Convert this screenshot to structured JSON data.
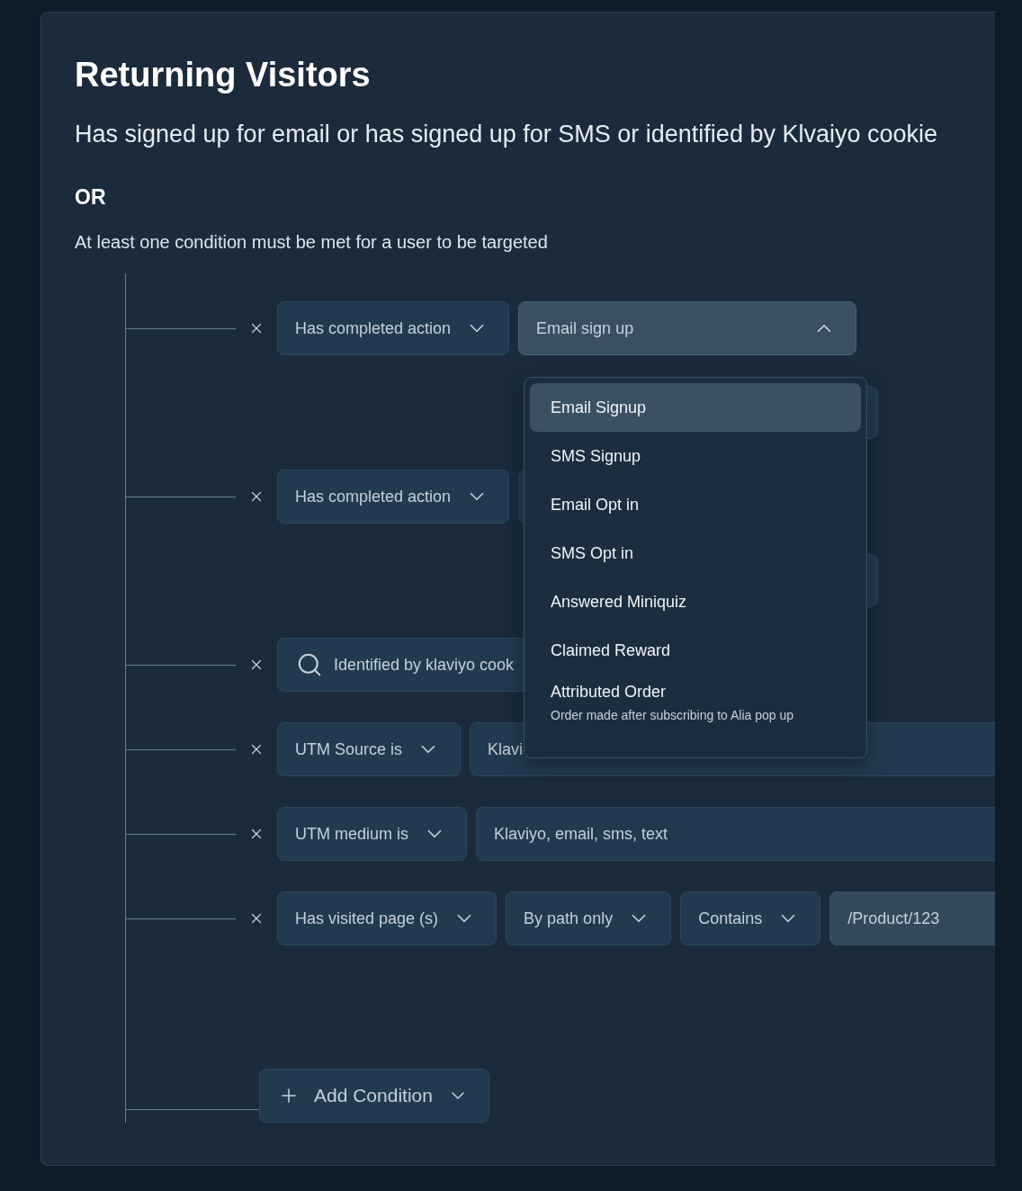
{
  "title": "Returning Visitors",
  "subtitle": "Has signed up for email or has signed up for SMS or identified by Klvaiyo cookie",
  "operator": "OR",
  "hint": "At least one condition must be met for a user to be targeted",
  "rows": [
    {
      "kind": "condition",
      "controls": [
        {
          "kind": "select",
          "value": "Has completed action",
          "expanded": false
        },
        {
          "kind": "select",
          "value": "Email sign up",
          "expanded": true
        }
      ]
    },
    {
      "kind": "covered"
    },
    {
      "kind": "condition",
      "controls": [
        {
          "kind": "select",
          "value": "Has completed action",
          "expanded": false
        },
        {
          "kind": "covered"
        }
      ]
    },
    {
      "kind": "covered"
    },
    {
      "kind": "condition",
      "controls": [
        {
          "kind": "search",
          "value": "Identified by klaviyo cook"
        }
      ]
    },
    {
      "kind": "condition",
      "controls": [
        {
          "kind": "select",
          "value": "UTM Source is",
          "expanded": false
        },
        {
          "kind": "text",
          "value": "Klavi"
        }
      ]
    },
    {
      "kind": "condition",
      "controls": [
        {
          "kind": "select",
          "value": "UTM medium is",
          "expanded": false
        },
        {
          "kind": "text",
          "value": "Klaviyo, email, sms, text"
        }
      ]
    },
    {
      "kind": "condition",
      "controls": [
        {
          "kind": "select",
          "value": "Has visited page (s)",
          "expanded": false
        },
        {
          "kind": "select",
          "value": "By path only",
          "expanded": false
        },
        {
          "kind": "select",
          "value": "Contains",
          "expanded": false
        },
        {
          "kind": "input",
          "value": "/Product/123"
        }
      ]
    }
  ],
  "add_button": "Add Condition",
  "menu": {
    "items": [
      {
        "label": "Email Signup",
        "selected": true
      },
      {
        "label": "SMS Signup",
        "selected": false
      },
      {
        "label": "Email Opt in",
        "selected": false
      },
      {
        "label": "SMS Opt in",
        "selected": false
      },
      {
        "label": "Answered Miniquiz",
        "selected": false
      },
      {
        "label": "Claimed Reward",
        "selected": false
      },
      {
        "label": "Attributed Order",
        "selected": false,
        "description": "Order made after subscribing to Alia pop up"
      }
    ]
  }
}
